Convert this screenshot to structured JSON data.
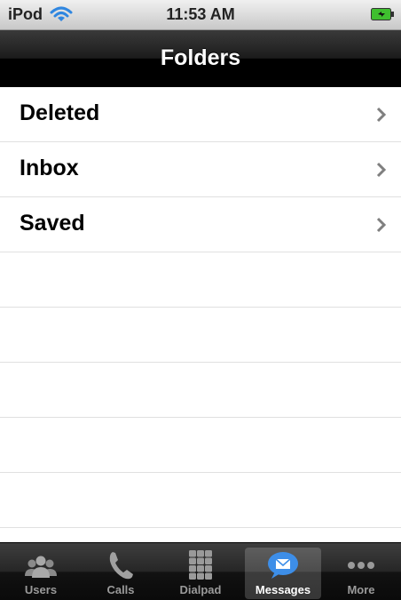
{
  "status_bar": {
    "device": "iPod",
    "time": "11:53 AM"
  },
  "nav": {
    "title": "Folders"
  },
  "folders": [
    {
      "label": "Deleted"
    },
    {
      "label": "Inbox"
    },
    {
      "label": "Saved"
    }
  ],
  "empty_rows": 5,
  "tabs": [
    {
      "label": "Users",
      "icon": "users-icon"
    },
    {
      "label": "Calls",
      "icon": "phone-icon"
    },
    {
      "label": "Dialpad",
      "icon": "dialpad-icon"
    },
    {
      "label": "Messages",
      "icon": "message-icon",
      "selected": true
    },
    {
      "label": "More",
      "icon": "more-icon"
    }
  ],
  "colors": {
    "accent": "#3d8ee8",
    "battery": "#3fbf2f"
  }
}
